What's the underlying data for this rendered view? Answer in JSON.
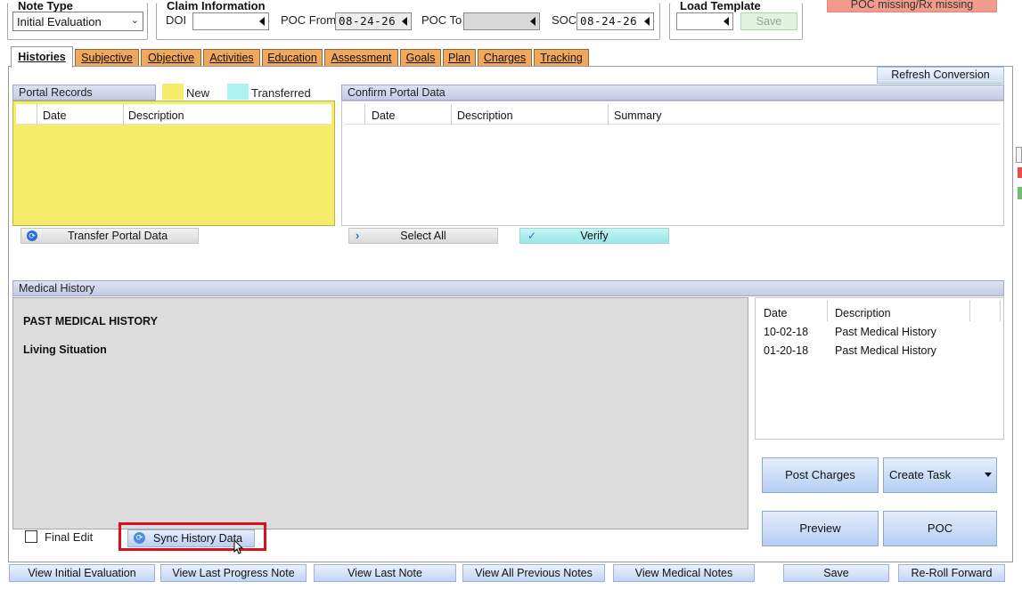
{
  "note_type": {
    "legend": "Note Type",
    "value": "Initial Evaluation"
  },
  "claim_info": {
    "legend": "Claim Information",
    "doi_label": "DOI",
    "doi_value": "",
    "poc_from_label": "POC From",
    "poc_from_value": "08-24-26",
    "poc_to_label": "POC To",
    "poc_to_value": "",
    "soc_label": "SOC",
    "soc_value": "08-24-26"
  },
  "load_template": {
    "legend": "Load Template",
    "value": "",
    "save_label": "Save"
  },
  "alert": {
    "text": "POC missing/Rx missing"
  },
  "tabs": [
    {
      "label": "Histories"
    },
    {
      "label": "Subjective"
    },
    {
      "label": "Objective"
    },
    {
      "label": "Activities"
    },
    {
      "label": "Education"
    },
    {
      "label": "Assessment"
    },
    {
      "label": "Goals"
    },
    {
      "label": "Plan"
    },
    {
      "label": "Charges"
    },
    {
      "label": "Tracking"
    }
  ],
  "refresh_conversion_label": "Refresh Conversion",
  "portal_records": {
    "title": "Portal Records",
    "legend_new": "New",
    "legend_transferred": "Transferred",
    "columns": [
      "Date",
      "Description"
    ],
    "transfer_button": "Transfer Portal Data"
  },
  "confirm_portal": {
    "title": "Confirm Portal Data",
    "columns": [
      "Date",
      "Description",
      "Summary"
    ],
    "select_all": "Select All",
    "verify": "Verify"
  },
  "medical_history": {
    "title": "Medical History",
    "sections": [
      "PAST MEDICAL HISTORY",
      "Living Situation"
    ],
    "final_edit_label": "Final Edit",
    "sync_button": "Sync History Data",
    "table_columns": [
      "Date",
      "Description"
    ],
    "rows": [
      {
        "date": "10-02-18",
        "description": "Past Medical History"
      },
      {
        "date": "01-20-18",
        "description": "Past Medical History"
      }
    ]
  },
  "actions": {
    "post_charges": "Post Charges",
    "create_task": "Create Task",
    "preview": "Preview",
    "poc": "POC"
  },
  "bottom_bar": {
    "view_initial_eval": "View Initial Evaluation",
    "view_last_progress": "View Last Progress Note",
    "view_last_note": "View Last Note",
    "view_all_prev": "View All Previous Notes",
    "view_medical": "View Medical Notes",
    "save": "Save",
    "reroll": "Re-Roll Forward"
  },
  "colors": {
    "tab_orange": "#f1a85d",
    "portal_yellow": "#f5ec6a",
    "transferred_cyan": "#aef3f3",
    "alert_red": "#f39b8b",
    "highlight_red": "#d9101e"
  }
}
